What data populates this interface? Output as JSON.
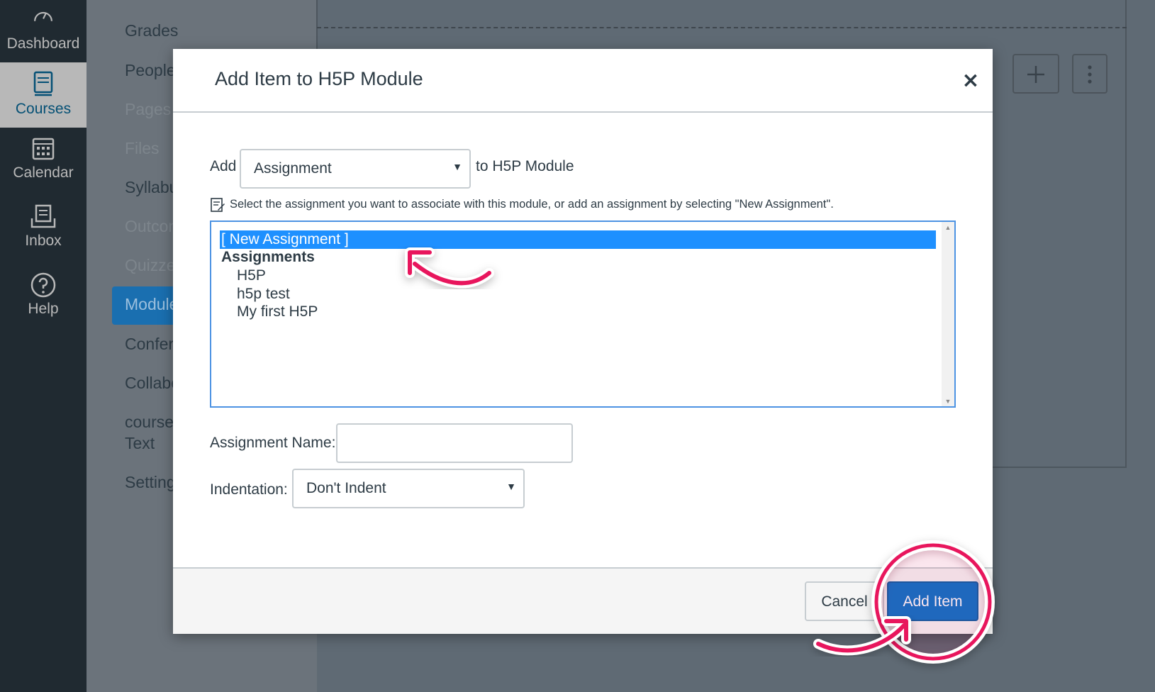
{
  "global_nav": {
    "items": [
      {
        "label": "Dashboard",
        "icon": "dashboard-icon"
      },
      {
        "label": "Courses",
        "icon": "courses-icon"
      },
      {
        "label": "Calendar",
        "icon": "calendar-icon"
      },
      {
        "label": "Inbox",
        "icon": "inbox-icon"
      },
      {
        "label": "Help",
        "icon": "help-icon"
      }
    ]
  },
  "course_nav": {
    "items": [
      "Grades",
      "People",
      "Pages",
      "Files",
      "Syllabus",
      "Outcomes",
      "Quizzes",
      "Modules",
      "Conferences",
      "Collaborations",
      "course",
      "Text",
      "Settings"
    ]
  },
  "modal": {
    "title": "Add Item to H5P Module",
    "close_label": "×",
    "add_label": "Add",
    "type_select_value": "Assignment",
    "to_label": "to H5P Module",
    "hint": "Select the assignment you want to associate with this module, or add an assignment by selecting \"New Assignment\".",
    "list": {
      "selected": "[ New Assignment ]",
      "group": "Assignments",
      "items": [
        "H5P",
        "h5p test",
        "My first H5P"
      ]
    },
    "name_label": "Assignment Name:",
    "name_value": "",
    "indent_label": "Indentation:",
    "indent_value": "Don't Indent",
    "cancel_label": "Cancel",
    "add_item_label": "Add Item"
  },
  "colors": {
    "accent": "#0c73c9",
    "selection": "#1e90ff",
    "annotation": "#e8175d",
    "nav_bg": "#2d3b45"
  }
}
